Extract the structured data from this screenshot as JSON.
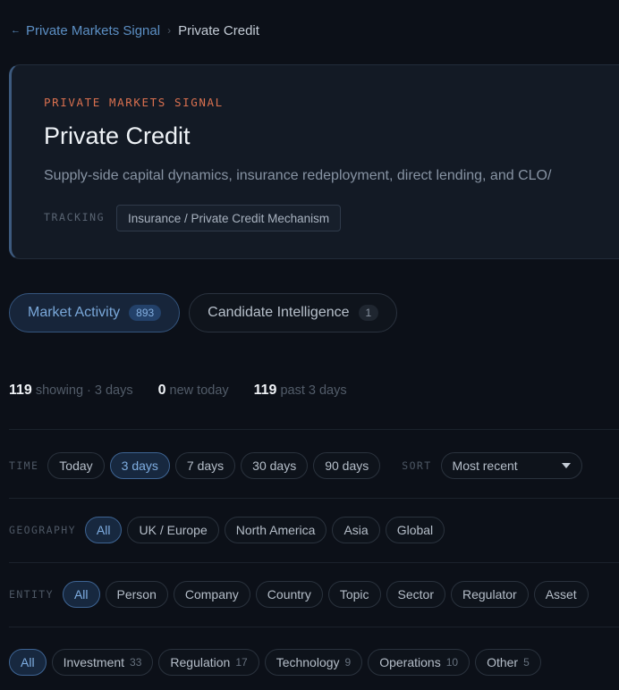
{
  "breadcrumb": {
    "back_arrow": "←",
    "parent": "Private Markets Signal",
    "separator": "›",
    "current": "Private Credit"
  },
  "header": {
    "eyebrow": "PRIVATE MARKETS SIGNAL",
    "title": "Private Credit",
    "description": "Supply-side capital dynamics, insurance redeployment, direct lending, and CLO/",
    "tracking_label": "TRACKING",
    "tracking_value": "Insurance / Private Credit Mechanism"
  },
  "tabs": [
    {
      "label": "Market Activity",
      "count": "893",
      "active": true
    },
    {
      "label": "Candidate Intelligence",
      "count": "1",
      "active": false
    }
  ],
  "stats": {
    "showing_count": "119",
    "showing_label": "showing · 3 days",
    "new_count": "0",
    "new_label": "new today",
    "past_count": "119",
    "past_label": "past 3 days"
  },
  "filters": {
    "time": {
      "label": "TIME",
      "options": [
        "Today",
        "3 days",
        "7 days",
        "30 days",
        "90 days"
      ],
      "selected": "3 days"
    },
    "sort": {
      "label": "SORT",
      "value": "Most recent"
    },
    "geography": {
      "label": "GEOGRAPHY",
      "options": [
        "All",
        "UK / Europe",
        "North America",
        "Asia",
        "Global"
      ],
      "selected": "All"
    },
    "entity": {
      "label": "ENTITY",
      "options": [
        "All",
        "Person",
        "Company",
        "Country",
        "Topic",
        "Sector",
        "Regulator",
        "Asset"
      ],
      "selected": "All"
    },
    "category": {
      "options": [
        {
          "label": "All",
          "count": ""
        },
        {
          "label": "Investment",
          "count": "33"
        },
        {
          "label": "Regulation",
          "count": "17"
        },
        {
          "label": "Technology",
          "count": "9"
        },
        {
          "label": "Operations",
          "count": "10"
        },
        {
          "label": "Other",
          "count": "5"
        }
      ],
      "selected": "All"
    }
  },
  "colors": {
    "background": "#0c1018",
    "accent": "#79a7d9",
    "eyebrow": "#d9704f"
  }
}
